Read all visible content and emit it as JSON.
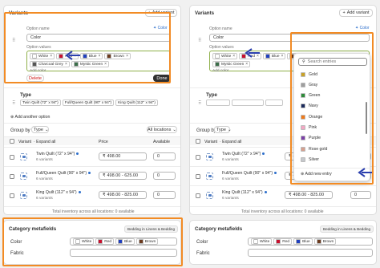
{
  "left": {
    "variants_title": "Variants",
    "add_variant": "Add variant",
    "option_name_label": "Option name",
    "option_name_value": "Color",
    "color_link": "Color",
    "option_values_label": "Option values",
    "values": [
      {
        "label": "White",
        "color": "#ffffff"
      },
      {
        "label": "Red",
        "color": "#c8102e"
      },
      {
        "label": "Blue",
        "color": "#1f3fbf"
      },
      {
        "label": "Brown",
        "color": "#6b3a1e"
      },
      {
        "label": "Charcoal Grey",
        "color": "#555555"
      },
      {
        "label": "Mystic Green",
        "color": "#3b6e4a"
      }
    ],
    "add_color_placeholder": "Add color",
    "delete": "Delete",
    "done": "Done",
    "type_label": "Type",
    "type_values": [
      "Twin Quilt (72\" x 94\")",
      "Full/Queen Quilt (90\" x 94\")",
      "King Quilt (112\" x 94\")"
    ],
    "add_another_option": "Add another option",
    "group_by_label": "Group by",
    "group_by_value": "Type",
    "all_locations": "All locations",
    "table_head": {
      "variant": "Variant",
      "expand": "· Expand all",
      "price": "Price",
      "available": "Available"
    },
    "rows": [
      {
        "name": "Twin Quilt (72\" x 94\")",
        "variants": "6 variants",
        "currency": "₹",
        "price": "498.00",
        "available": "0"
      },
      {
        "name": "Full/Queen Quilt (90\" x 94\")",
        "variants": "6 variants",
        "currency": "₹",
        "price": "498.00 - 625.00",
        "available": "0"
      },
      {
        "name": "King Quilt (112\" x 94\")",
        "variants": "6 variants",
        "currency": "₹",
        "price": "498.00 - 825.00",
        "available": "0"
      }
    ],
    "total_inventory": "Total inventory across all locations: 0 available",
    "metafields_title": "Category metafields",
    "metafields_category": "Bedding in Linens & Bedding",
    "meta_color_label": "Color",
    "meta_color_chips": [
      {
        "label": "White",
        "color": "#ffffff"
      },
      {
        "label": "Red",
        "color": "#c8102e"
      },
      {
        "label": "Blue",
        "color": "#1f3fbf"
      },
      {
        "label": "Brown",
        "color": "#6b3a1e"
      }
    ],
    "meta_fabric_label": "Fabric"
  },
  "right": {
    "variants_title": "Variants",
    "add_variant": "Add variant",
    "option_name_label": "Option name",
    "option_name_value": "Color",
    "color_link": "Color",
    "option_values_label": "Option values",
    "values": [
      {
        "label": "White",
        "color": "#ffffff"
      },
      {
        "label": "Red",
        "color": "#c8102e"
      },
      {
        "label": "Blue",
        "color": "#1f3fbf"
      },
      {
        "label": "Brown",
        "color": "#6b3a1e"
      },
      {
        "label": "Charcoal Grey",
        "color": "#555555"
      },
      {
        "label": "Mystic Green",
        "color": "#3b6e4a"
      }
    ],
    "add_color_placeholder": "Add color",
    "search_placeholder": "Search entries",
    "dropdown_items": [
      {
        "label": "Gold",
        "color": "#c9a227"
      },
      {
        "label": "Gray",
        "color": "#9e9e9e"
      },
      {
        "label": "Green",
        "color": "#2e8b3a"
      },
      {
        "label": "Navy",
        "color": "#1b2a5c"
      },
      {
        "label": "Orange",
        "color": "#f07a1a"
      },
      {
        "label": "Pink",
        "color": "#f2a7c3"
      },
      {
        "label": "Purple",
        "color": "#7b3fa8"
      },
      {
        "label": "Rose gold",
        "color": "#d6a08f"
      },
      {
        "label": "Silver",
        "color": "#c5c8cc"
      }
    ],
    "add_new_entry": "Add new entry",
    "type_label": "Type",
    "group_by_label": "Group by",
    "group_by_value": "Type",
    "table_head": {
      "variant": "Variant",
      "expand": "· Expand all"
    },
    "rows": [
      {
        "name": "Twin Quilt (72\" x 94\")",
        "variants": "6 variants",
        "currency": "₹",
        "price": "498.00",
        "available": "0"
      },
      {
        "name": "Full/Queen Quilt (90\" x 94\")",
        "variants": "6 variants",
        "currency": "₹",
        "price": "498.00 - 625.00",
        "available": "0"
      },
      {
        "name": "King Quilt (112\" x 94\")",
        "variants": "6 variants",
        "currency": "₹",
        "price": "498.00 - 825.00",
        "available": "0"
      }
    ],
    "total_inventory": "Total inventory across all locations: 0 available",
    "metafields_title": "Category metafields",
    "metafields_category": "Bedding in Linens & Bedding",
    "meta_color_label": "Color",
    "meta_color_chips": [
      {
        "label": "White",
        "color": "#ffffff"
      },
      {
        "label": "Red",
        "color": "#c8102e"
      },
      {
        "label": "Blue",
        "color": "#1f3fbf"
      },
      {
        "label": "Brown",
        "color": "#6b3a1e"
      }
    ],
    "meta_fabric_label": "Fabric"
  },
  "colors": {
    "highlight": "#f28b24",
    "arrow": "#2b3fae",
    "done_bg": "#303030"
  }
}
